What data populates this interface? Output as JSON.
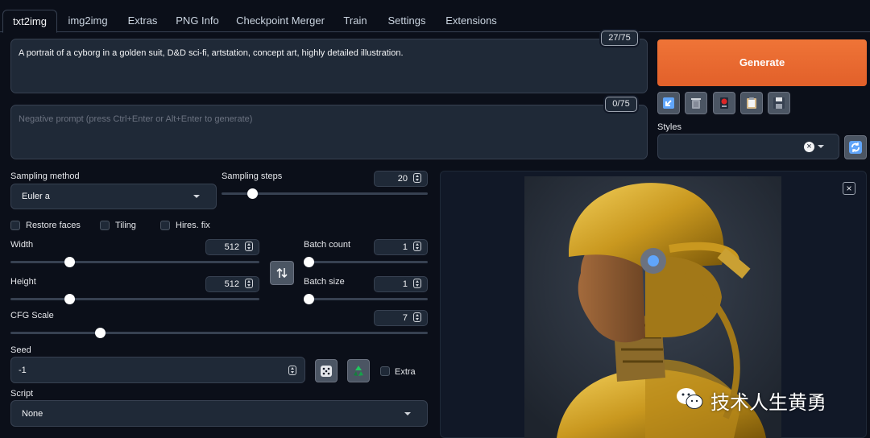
{
  "tabs": [
    "txt2img",
    "img2img",
    "Extras",
    "PNG Info",
    "Checkpoint Merger",
    "Train",
    "Settings",
    "Extensions"
  ],
  "prompt": {
    "text": "A portrait of a cyborg in a golden suit, D&D sci-fi, artstation, concept art, highly detailed illustration.",
    "token_count": "27/75"
  },
  "negative_prompt": {
    "placeholder": "Negative prompt (press Ctrl+Enter or Alt+Enter to generate)",
    "token_count": "0/75"
  },
  "actions": {
    "generate_label": "Generate",
    "tools": [
      "arrow-icon",
      "trash-icon",
      "red-card-icon",
      "clipboard-icon",
      "save-icon"
    ]
  },
  "styles": {
    "label": "Styles",
    "value": "",
    "clear_symbol": "×"
  },
  "sampling": {
    "method_label": "Sampling method",
    "method_value": "Euler a",
    "steps_label": "Sampling steps",
    "steps_value": "20",
    "steps_level": 0.2
  },
  "checkboxes": {
    "restore_faces": "Restore faces",
    "tiling": "Tiling",
    "hires_fix": "Hires. fix"
  },
  "width": {
    "label": "Width",
    "value": "512",
    "level": 0.2
  },
  "height": {
    "label": "Height",
    "value": "512",
    "level": 0.2
  },
  "batch_count": {
    "label": "Batch count",
    "value": "1",
    "level": 0.0
  },
  "batch_size": {
    "label": "Batch size",
    "value": "1",
    "level": 0.0
  },
  "cfg_scale": {
    "label": "CFG Scale",
    "value": "7",
    "level": 0.2
  },
  "seed": {
    "label": "Seed",
    "value": "-1",
    "extra_label": "Extra"
  },
  "script": {
    "label": "Script",
    "value": "None"
  },
  "output": {
    "watermark": "技术人生黄勇"
  },
  "colors": {
    "accent": "#ea6a2d",
    "background": "#0b0f19",
    "surface": "#1f2937"
  }
}
